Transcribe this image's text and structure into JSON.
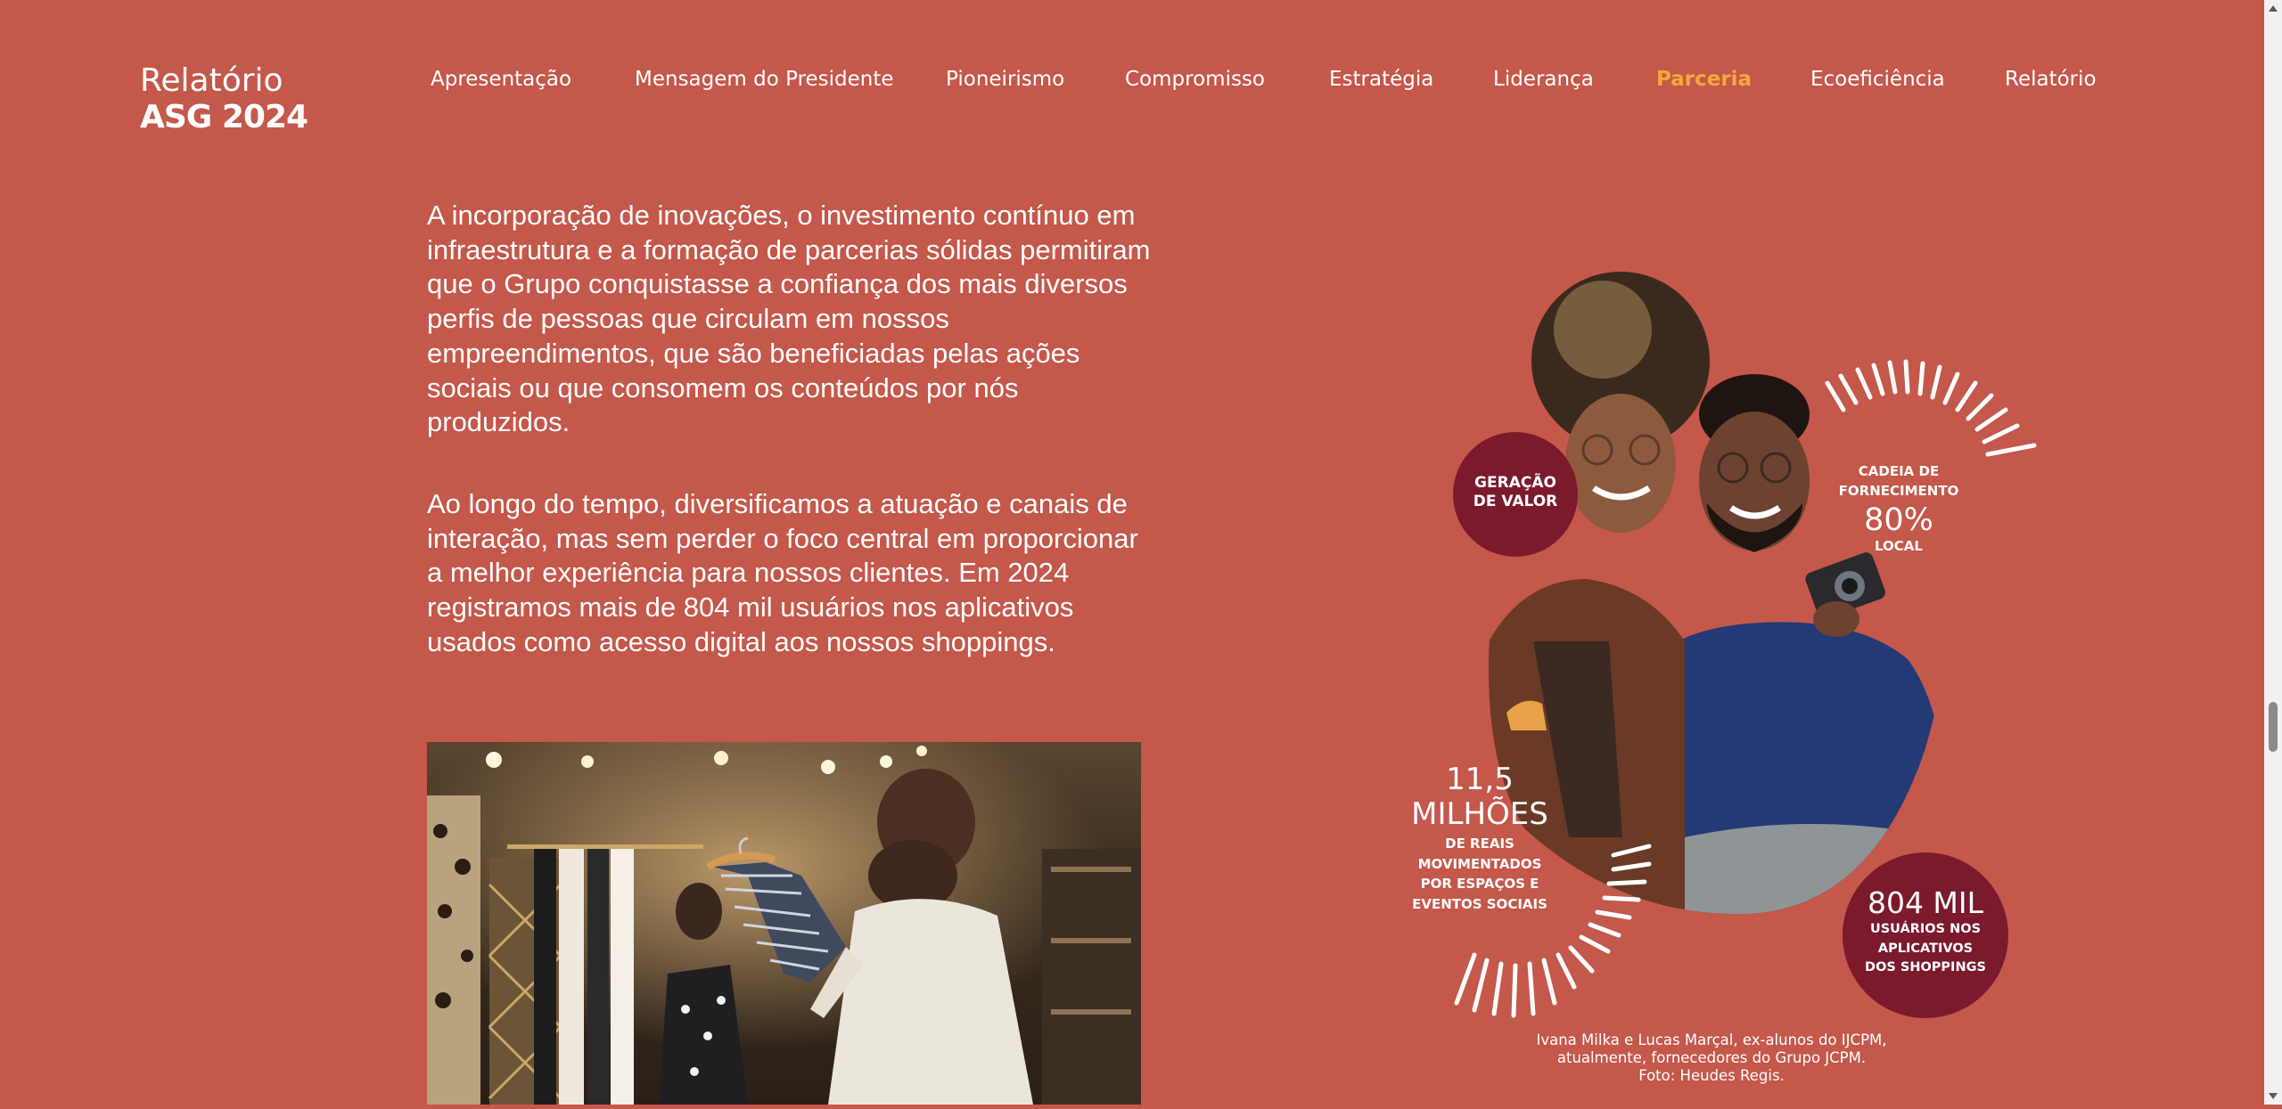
{
  "header": {
    "logo_line1": "Relatório",
    "logo_line2": "ASG 2024"
  },
  "nav": {
    "items": [
      {
        "label": "Apresentação",
        "active": false
      },
      {
        "label": "Mensagem do Presidente",
        "active": false
      },
      {
        "label": "Pioneirismo",
        "active": false
      },
      {
        "label": "Compromisso",
        "active": false
      },
      {
        "label": "Estratégia",
        "active": false
      },
      {
        "label": "Liderança",
        "active": false
      },
      {
        "label": "Parceria",
        "active": true
      },
      {
        "label": "Ecoeficiência",
        "active": false
      },
      {
        "label": "Relatório",
        "active": false
      }
    ]
  },
  "content": {
    "paragraph1": "A incorporação de inovações, o investimento contínuo em infraestrutura e a formação de parcerias sólidas permitiram que o Grupo conquistasse a confiança dos mais diversos perfis de pessoas que circulam em nossos empreendimentos, que são beneficiadas pelas ações sociais ou que consomem os conteúdos por nós produzidos.",
    "paragraph2": "Ao longo do tempo, diversificamos a atuação e canais de interação, mas sem perder o foco central em proporcionar a melhor experiência para nossos clientes. Em 2024 registramos mais de 804 mil usuários nos aplicativos usados como acesso digital aos nossos shoppings."
  },
  "infographic": {
    "geracao_line1": "GERAÇÃO",
    "geracao_line2": "DE VALOR",
    "cadeia_line1": "CADEIA DE",
    "cadeia_line2": "FORNECIMENTO",
    "cadeia_value": "80%",
    "cadeia_unit": "LOCAL",
    "milhoes_value": "11,5",
    "milhoes_unit": "MILHÕES",
    "milhoes_d1": "DE REAIS",
    "milhoes_d2": "MOVIMENTADOS",
    "milhoes_d3": "POR ESPAÇOS E",
    "milhoes_d4": "EVENTOS SOCIAIS",
    "usuarios_value": "804 MIL",
    "usuarios_d1": "USUÁRIOS NOS",
    "usuarios_d2": "APLICATIVOS",
    "usuarios_d3": "DOS SHOPPINGS"
  },
  "caption": {
    "line1": "Ivana Milka e Lucas Marçal, ex-alunos do IJCPM,",
    "line2": "atualmente, fornecedores do Grupo JCPM.",
    "line3": "Foto: Heudes Regis."
  },
  "colors": {
    "background": "#c4584b",
    "active_nav": "#f2a93b",
    "circle": "#7a1a2c"
  }
}
